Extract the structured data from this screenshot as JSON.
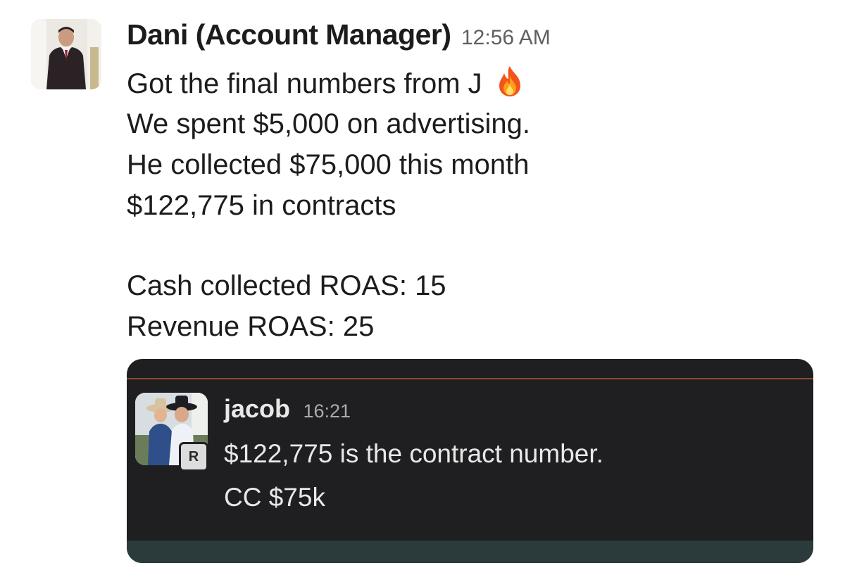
{
  "message": {
    "sender": "Dani (Account Manager)",
    "timestamp": "12:56 AM",
    "avatar_icon": "profile-photo-man-in-suit",
    "lines": [
      "Got the final numbers from J",
      "We spent $5,000 on advertising.",
      "He collected $75,000 this month",
      "$122,775 in contracts",
      "",
      "Cash collected ROAS: 15",
      "Revenue ROAS: 25"
    ],
    "emoji_icon": "fire-emoji"
  },
  "reply": {
    "sender": "jacob",
    "timestamp": "16:21",
    "badge": "R",
    "avatar_icon": "profile-photo-men-in-cowboy-hats",
    "lines": [
      "$122,775 is the contract number.",
      "CC $75k"
    ]
  },
  "colors": {
    "card_background": "#1f1f22",
    "card_divider": "#8c4a2f",
    "sender_text": "#1d1c1d",
    "timestamp_text": "#616061"
  }
}
